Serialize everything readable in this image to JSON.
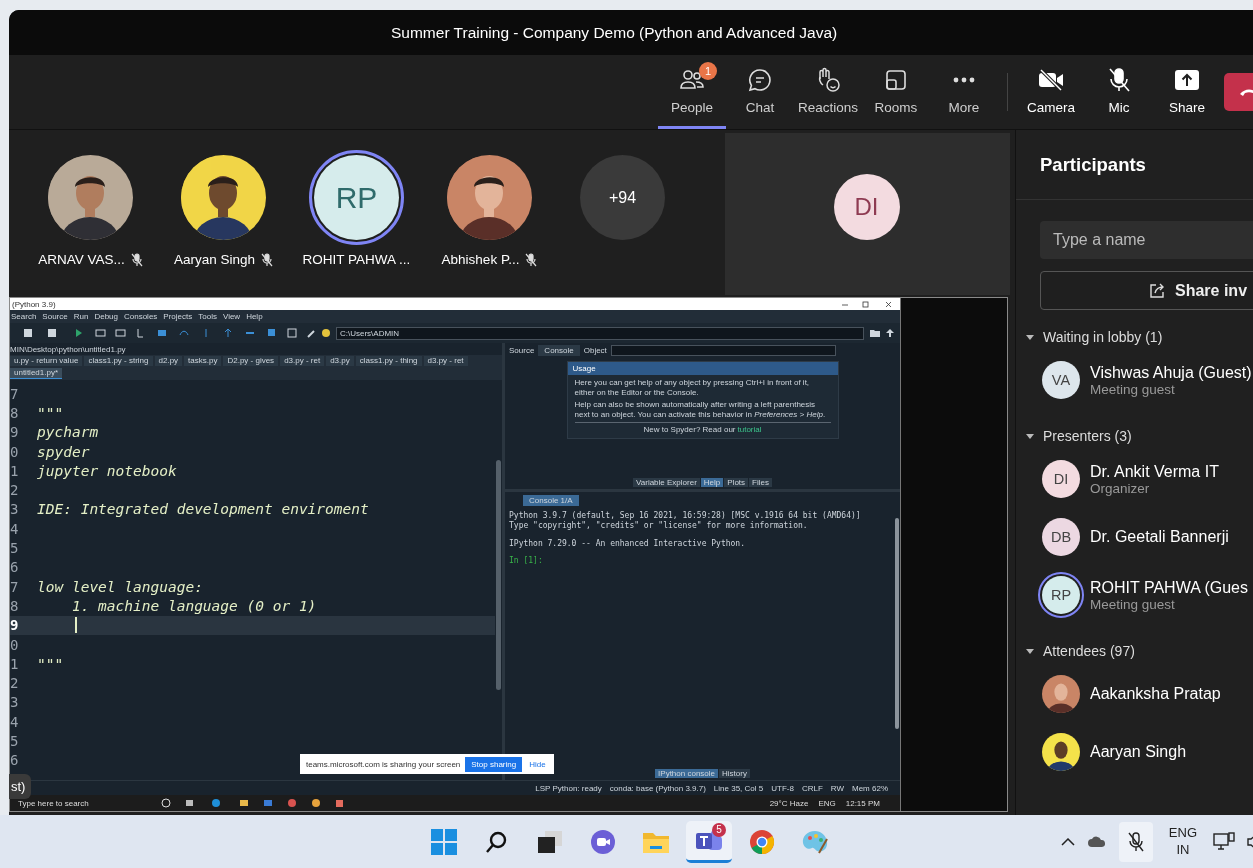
{
  "window": {
    "title": "Summer Training - Company Demo (Python and Advanced Java)"
  },
  "toolbar": [
    {
      "kind": "people",
      "label": "People",
      "badge": "1",
      "selected": true
    },
    {
      "kind": "chat",
      "label": "Chat",
      "selected": false
    },
    {
      "kind": "reactions",
      "label": "Reactions",
      "selected": false
    },
    {
      "kind": "rooms",
      "label": "Rooms",
      "selected": false
    },
    {
      "kind": "more",
      "label": "More",
      "selected": false
    }
  ],
  "controls": [
    {
      "kind": "camera",
      "label": "Camera"
    },
    {
      "kind": "mic",
      "label": "Mic"
    },
    {
      "kind": "share",
      "label": "Share"
    },
    {
      "kind": "leave"
    }
  ],
  "tiles": [
    {
      "name": "ARNAV VAS...",
      "muted": true,
      "speaking": false
    },
    {
      "name": "Aaryan Singh",
      "muted": true,
      "speaking": false
    },
    {
      "kind": "initials",
      "initials": "RP",
      "name": "ROHIT PAHWA ...",
      "muted": false,
      "speaking": true
    },
    {
      "name": "Abhishek P...",
      "muted": true,
      "speaking": false
    },
    {
      "kind": "overflow",
      "label": "+94"
    }
  ],
  "spotlight": {
    "initials": "DI"
  },
  "share": {
    "title": "(Python 3.9)",
    "menu": [
      "Search",
      "Source",
      "Run",
      "Debug",
      "Consoles",
      "Projects",
      "Tools",
      "View",
      "Help"
    ],
    "path_field": "C:\\Users\\ADMIN",
    "file_path": "MIN\\Desktop\\python\\untitled1.py",
    "tabs": [
      {
        "label": "u.py - return value",
        "selected": false
      },
      {
        "label": "class1.py - string",
        "selected": false
      },
      {
        "label": "d2.py",
        "selected": false
      },
      {
        "label": "tasks.py",
        "selected": false
      },
      {
        "label": "D2.py - gives",
        "selected": false
      },
      {
        "label": "d3.py - ret",
        "selected": false
      },
      {
        "label": "d3.py",
        "selected": false
      },
      {
        "label": "class1.py - thing",
        "selected": false
      },
      {
        "label": "d3.py - ret",
        "selected": false
      },
      {
        "label": "untitled1.py*",
        "selected": true
      }
    ],
    "lines": [
      {
        "number": "7",
        "current": false
      },
      {
        "number": "8",
        "code": "\"\"\"",
        "current": false
      },
      {
        "number": "9",
        "code": "pycharm",
        "current": false
      },
      {
        "number": "0",
        "code": "spyder",
        "current": false
      },
      {
        "number": "1",
        "code": "jupyter notebook",
        "current": false
      },
      {
        "number": "2",
        "current": false
      },
      {
        "number": "3",
        "code": "IDE: Integrated development enviroment",
        "current": false
      },
      {
        "number": "4",
        "current": false
      },
      {
        "number": "5",
        "current": false
      },
      {
        "number": "6",
        "current": false
      },
      {
        "number": "7",
        "code": "low level language:",
        "current": false
      },
      {
        "number": "8",
        "code": "    1. machine language (0 or 1)",
        "current": false
      },
      {
        "number": "9",
        "current": true
      },
      {
        "number": "0",
        "current": false
      },
      {
        "number": "1",
        "code": "\"\"\"",
        "current": false
      },
      {
        "number": "2",
        "current": false
      },
      {
        "number": "3",
        "current": false
      },
      {
        "number": "4",
        "current": false
      },
      {
        "number": "5",
        "current": false
      },
      {
        "number": "6",
        "current": false
      }
    ],
    "help": {
      "source_label": "Source",
      "source_value": "Console",
      "object_label": "Object",
      "usage_title": "Usage",
      "paragraphs": [
        "Here you can get help of any object by pressing Ctrl+I in front of it, either on the Editor or the Console.",
        "Help can also be shown automatically after writing a left parenthesis next to an object. You can activate this behavior in *Preferences > Help*."
      ],
      "footer": "New to Spyder? Read our",
      "footer_link": "tutorial",
      "tabs": [
        {
          "label": "Variable Explorer",
          "selected": false
        },
        {
          "label": "Help",
          "selected": true
        },
        {
          "label": "Plots",
          "selected": false
        },
        {
          "label": "Files",
          "selected": false
        }
      ]
    },
    "console": {
      "tab": "Console 1/A",
      "lines": [
        {
          "kind": "text",
          "text": "Python 3.9.7 (default, Sep 16 2021, 16:59:28) [MSC v.1916 64 bit (AMD64)]"
        },
        {
          "kind": "text",
          "text": "Type \"copyright\", \"credits\" or \"license\" for more information."
        },
        {
          "kind": "section",
          "text": "IPython 7.29.0 -- An enhanced Interactive Python."
        },
        {
          "kind": "prompt",
          "text": "In [1]:"
        }
      ],
      "tabs": [
        {
          "label": "IPython console",
          "selected": true
        },
        {
          "label": "History",
          "selected": false
        }
      ]
    },
    "status": [
      "LSP Python: ready",
      "conda: base (Python 3.9.7)",
      "Line 35, Col 5",
      "UTF-8",
      "CRLF",
      "RW",
      "Mem 62%"
    ],
    "sharing_bar": {
      "message": "teams.microsoft.com is sharing your screen",
      "stop": "Stop sharing",
      "hide": "Hide"
    },
    "win_taskbar": {
      "search": "Type here to search",
      "weather": "29°C Haze",
      "lang": "ENG",
      "time": "12:15 PM"
    },
    "overlay_label": "st)"
  },
  "panel": {
    "title": "Participants",
    "search_placeholder": "Type a name",
    "invite": "Share inv",
    "groups": [
      {
        "label": "Waiting in lobby (1)",
        "expanded": true,
        "people": [
          {
            "kind": "initials",
            "initials": "VA",
            "color": "#dde6ec",
            "name": "Vishwas Ahuja (Guest)",
            "role": "Meeting guest",
            "speaking": false
          }
        ]
      },
      {
        "label": "Presenters (3)",
        "expanded": true,
        "people": [
          {
            "kind": "initials",
            "initials": "DI",
            "color": "#f3dbe0",
            "name": "Dr. Ankit Verma IT",
            "role": "Organizer",
            "speaking": false
          },
          {
            "kind": "initials",
            "initials": "DB",
            "color": "#ecd8e2",
            "name": "Dr. Geetali Bannerji",
            "speaking": false
          },
          {
            "kind": "initials",
            "initials": "RP",
            "color": "#d5ecec",
            "name": "ROHIT PAHWA (Gues",
            "role": "Meeting guest",
            "speaking": true
          }
        ]
      },
      {
        "label": "Attendees (97)",
        "expanded": true,
        "people": [
          {
            "name": "Aakanksha Pratap",
            "speaking": false
          },
          {
            "name": "Aaryan Singh",
            "speaking": false
          }
        ]
      }
    ]
  },
  "taskbar": {
    "apps": [
      {
        "kind": "start",
        "selected": false
      },
      {
        "kind": "search",
        "selected": false
      },
      {
        "kind": "taskview",
        "selected": false
      },
      {
        "kind": "meet",
        "selected": false
      },
      {
        "kind": "explorer",
        "selected": false
      },
      {
        "kind": "teams",
        "badge": "5",
        "selected": true
      },
      {
        "kind": "chrome",
        "selected": false
      },
      {
        "kind": "paint",
        "selected": false
      }
    ],
    "lang": "ENG",
    "region": "IN"
  }
}
